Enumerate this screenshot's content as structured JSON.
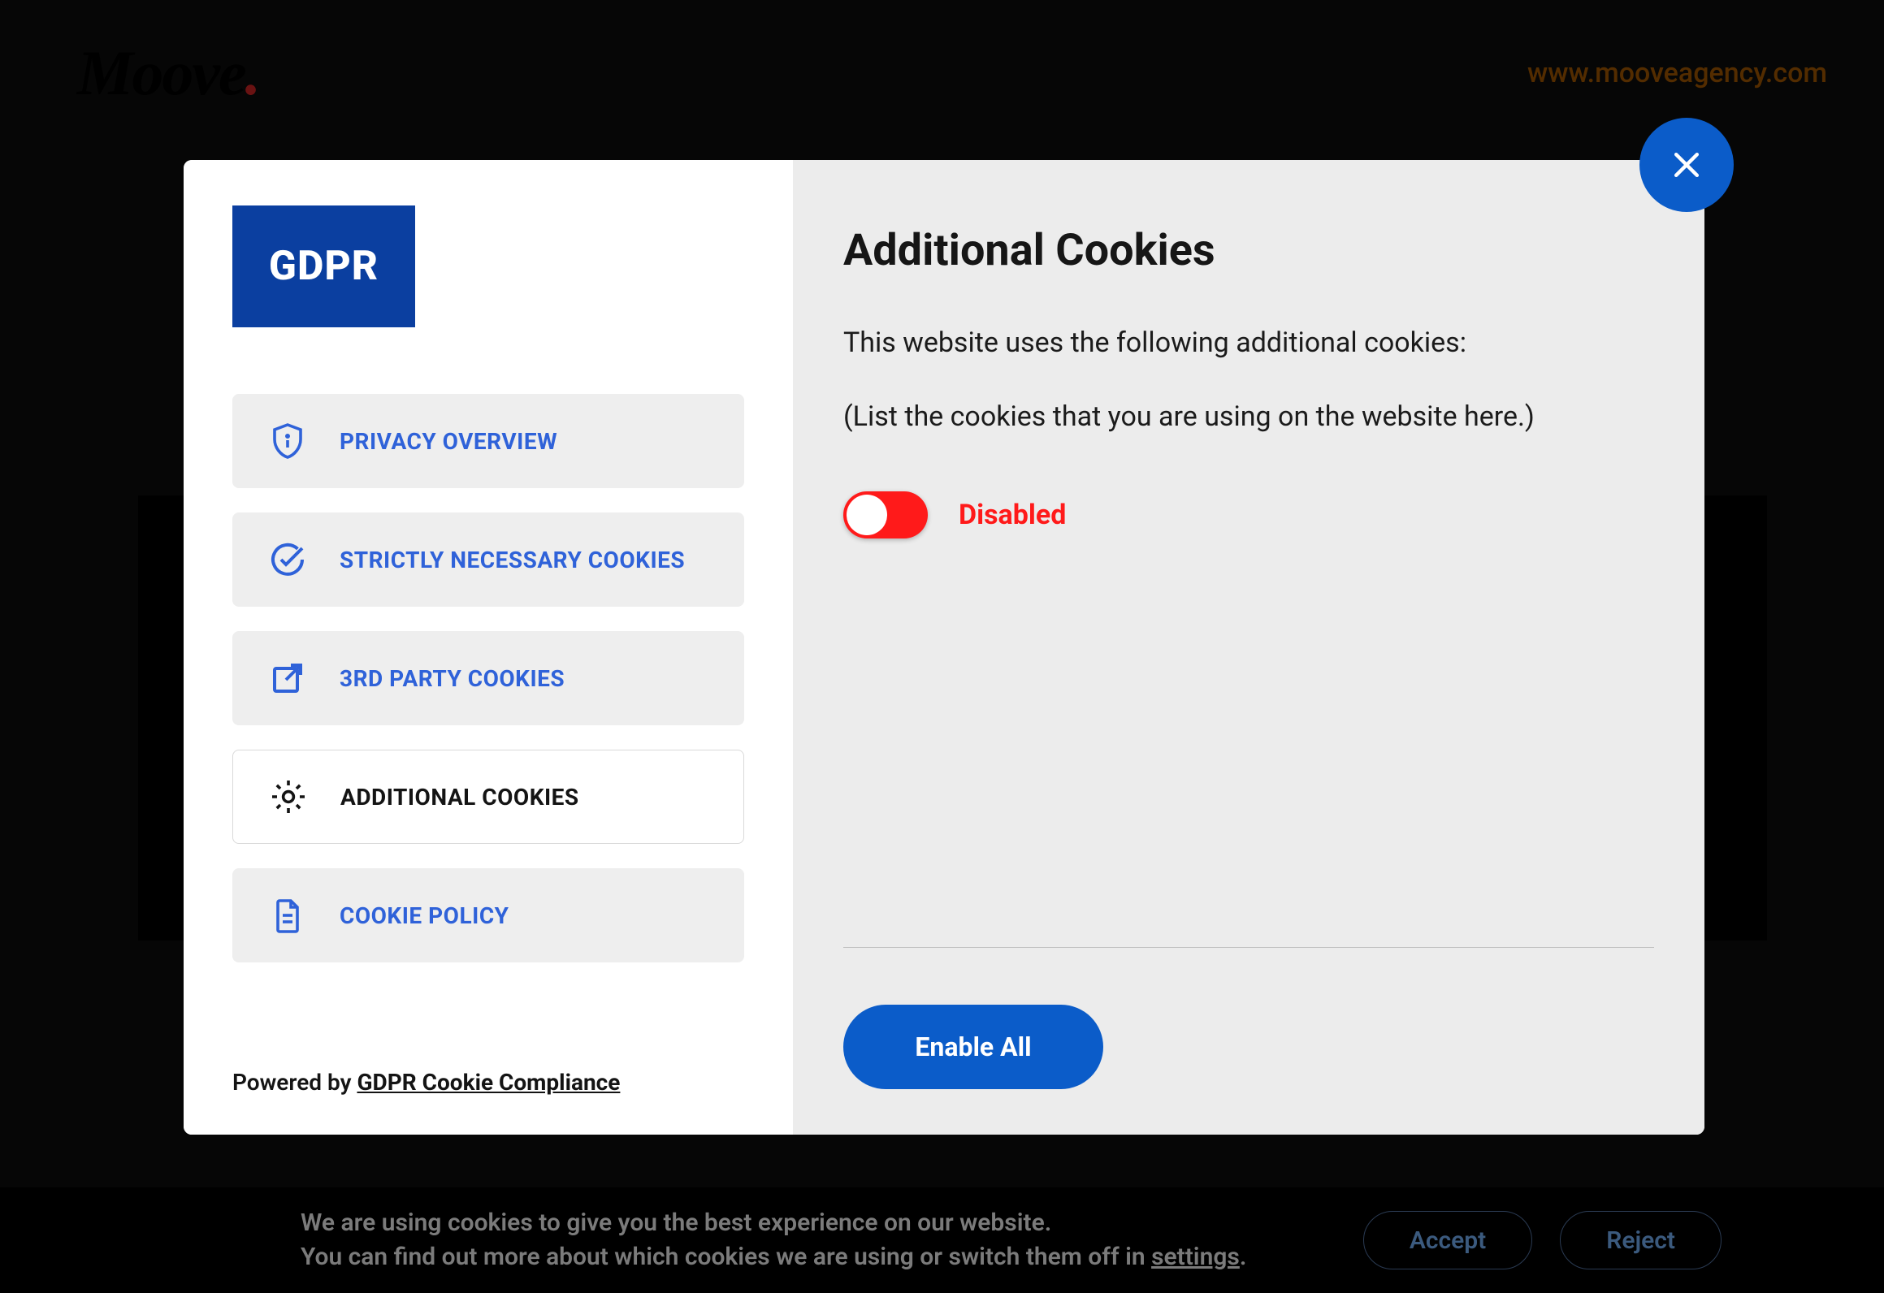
{
  "header": {
    "logo_text": "Moove",
    "site_url": "www.mooveagency.com"
  },
  "modal": {
    "close_label": "Close",
    "gdpr_badge": "GDPR",
    "nav": [
      {
        "id": "privacy-overview",
        "label": "PRIVACY OVERVIEW",
        "icon": "shield-info",
        "active": false
      },
      {
        "id": "strictly-necessary",
        "label": "STRICTLY NECESSARY COOKIES",
        "icon": "check-circle",
        "active": false
      },
      {
        "id": "third-party",
        "label": "3RD PARTY COOKIES",
        "icon": "external-link",
        "active": false
      },
      {
        "id": "additional-cookies",
        "label": "ADDITIONAL COOKIES",
        "icon": "gear",
        "active": true
      },
      {
        "id": "cookie-policy",
        "label": "COOKIE POLICY",
        "icon": "document",
        "active": false
      }
    ],
    "powered_prefix": "Powered by ",
    "powered_link": "GDPR Cookie Compliance",
    "panel": {
      "title": "Additional Cookies",
      "text1": "This website uses the following additional cookies:",
      "text2": "(List the cookies that you are using on the website here.)",
      "toggle_state": "Disabled",
      "enable_all": "Enable All"
    }
  },
  "cookie_bar": {
    "line1": "We are using cookies to give you the best experience on our website.",
    "line2_prefix": "You can find out more about which cookies we are using or switch them off in ",
    "settings_link": "settings",
    "line2_suffix": ".",
    "accept": "Accept",
    "reject": "Reject"
  },
  "colors": {
    "primary_blue": "#0b5cc9",
    "gdpr_blue": "#0b3fa0",
    "link_blue": "#2f62d9",
    "toggle_red": "#ff1a1a"
  }
}
